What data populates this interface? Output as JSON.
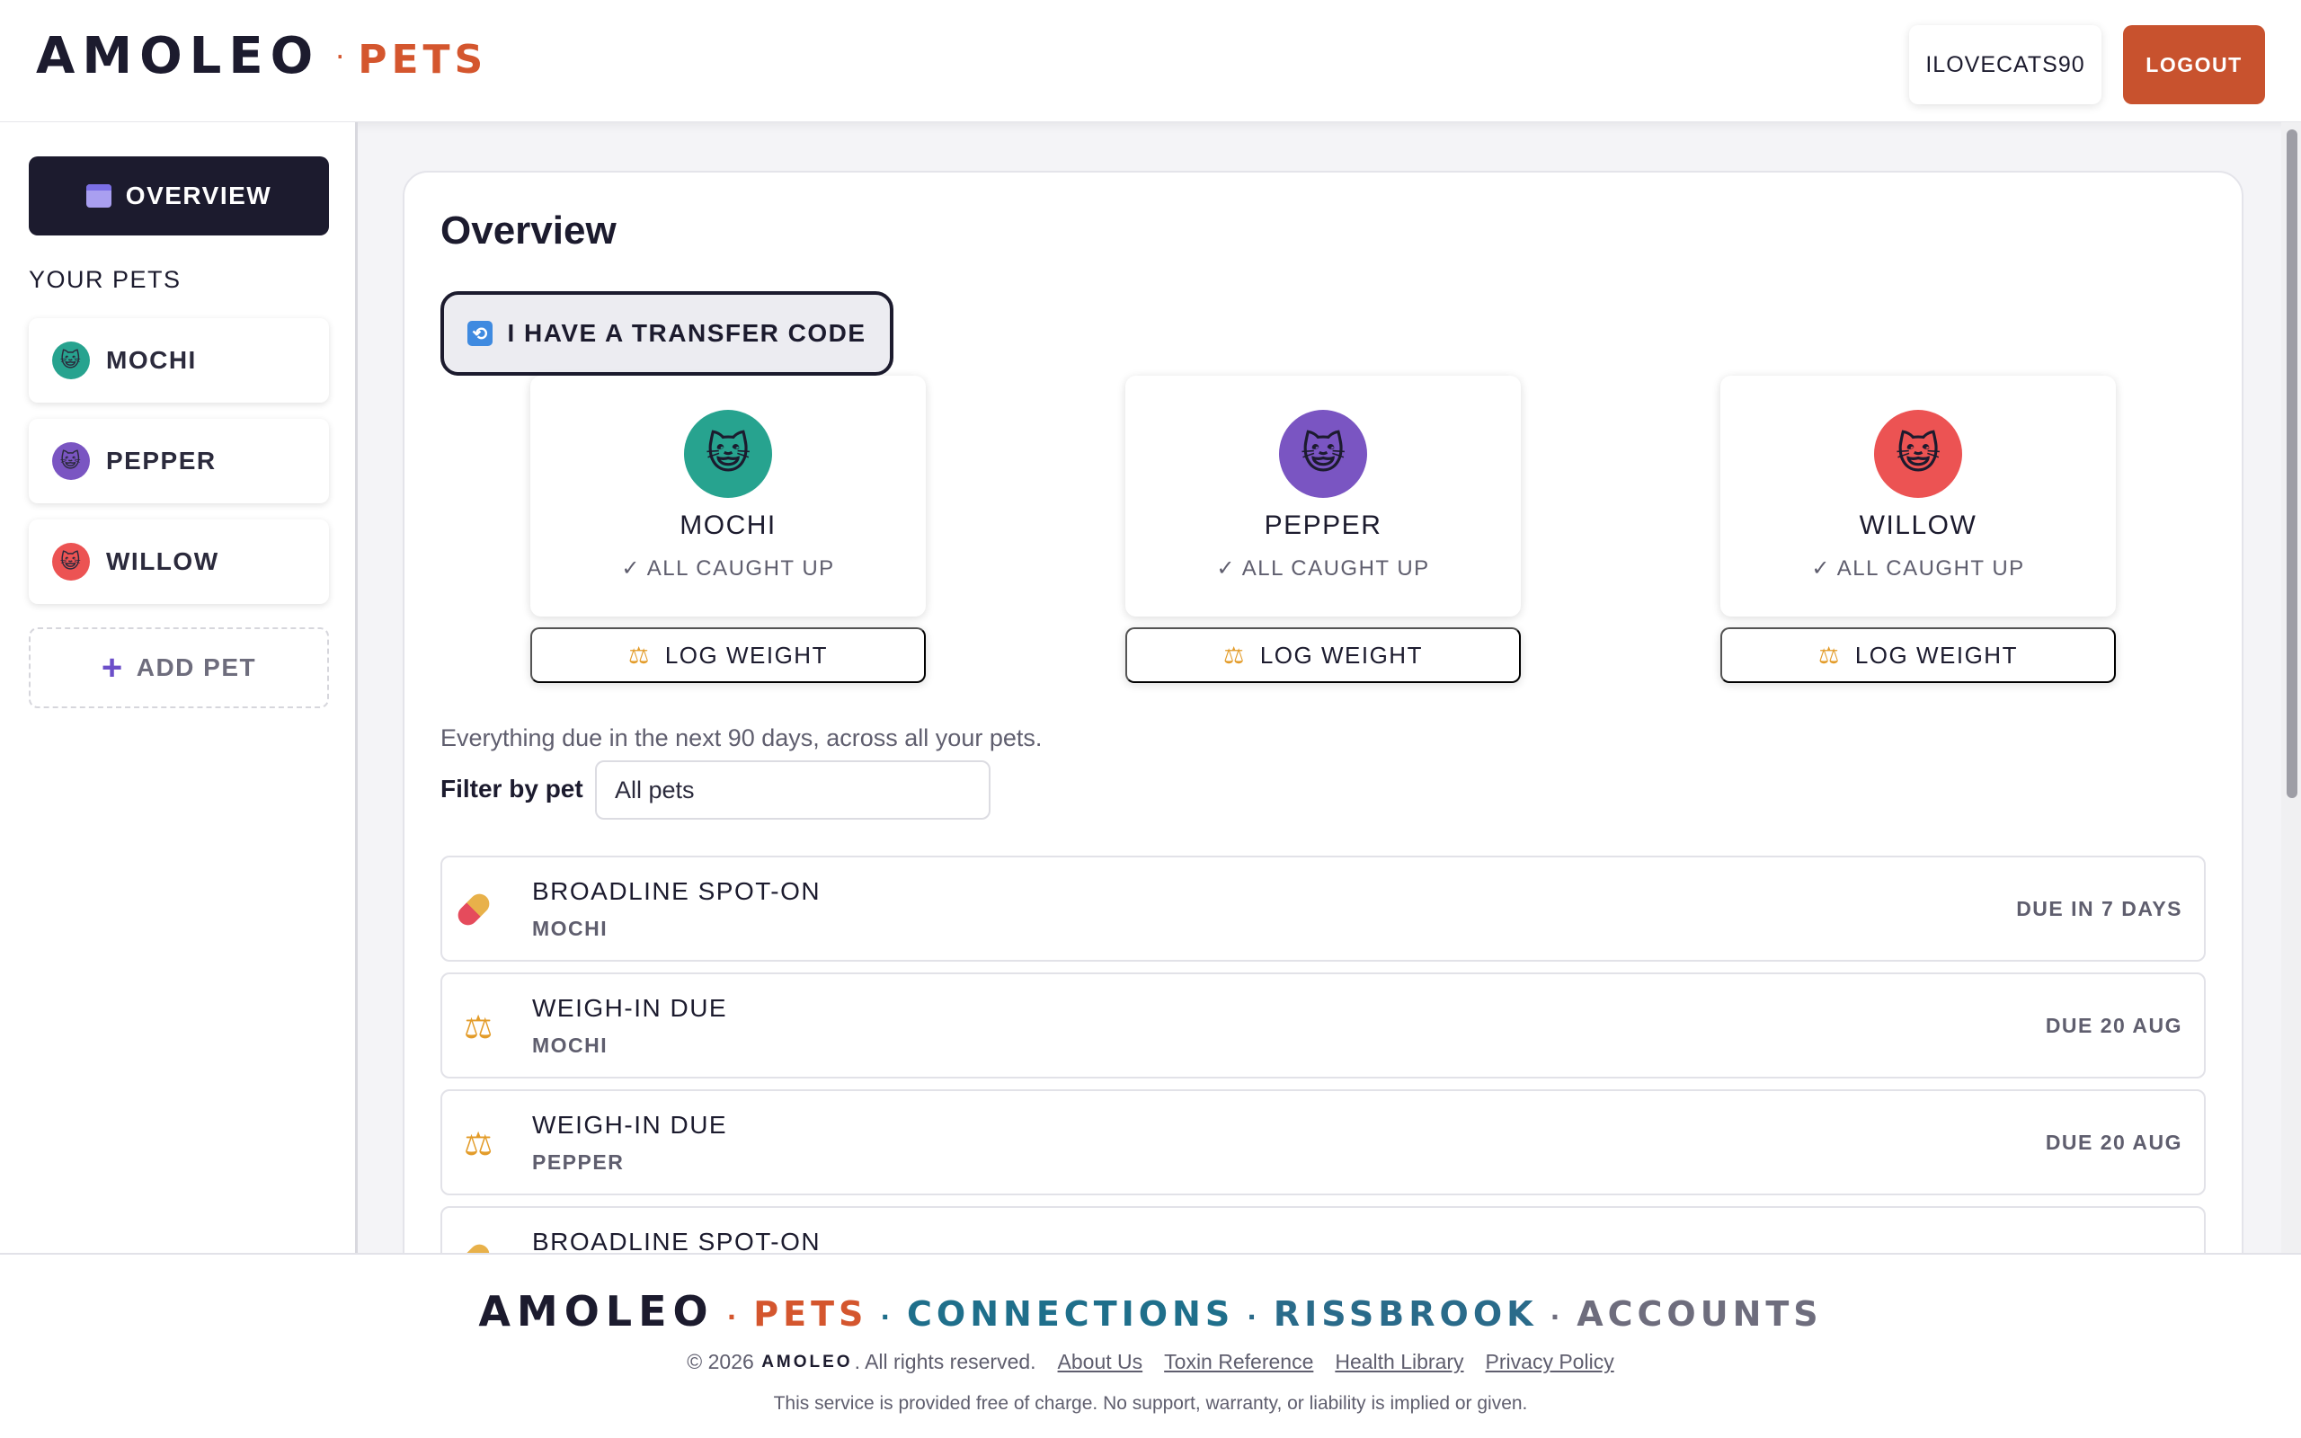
{
  "header": {
    "brand_main": "AMOLEO",
    "brand_dot": "·",
    "brand_sub": "PETS",
    "username": "ILOVECATS90",
    "logout_label": "LOGOUT"
  },
  "sidebar": {
    "overview_label": "OVERVIEW",
    "section_title": "YOUR PETS",
    "pets": [
      {
        "name": "MOCHI",
        "color": "#27a38f"
      },
      {
        "name": "PEPPER",
        "color": "#7a55c2"
      },
      {
        "name": "WILLOW",
        "color": "#ec5353"
      }
    ],
    "add_pet_label": "ADD PET",
    "add_pet_icon": "+"
  },
  "main": {
    "title": "Overview",
    "transfer_label": "I HAVE A TRANSFER CODE",
    "pet_cards": [
      {
        "name": "MOCHI",
        "status": "✓ ALL CAUGHT UP",
        "color": "#27a38f",
        "icon": "cat-face-icon"
      },
      {
        "name": "PEPPER",
        "status": "✓ ALL CAUGHT UP",
        "color": "#7a55c2",
        "icon": "cat-face-icon"
      },
      {
        "name": "WILLOW",
        "status": "✓ ALL CAUGHT UP",
        "color": "#ec5353",
        "icon": "cat-face-icon"
      }
    ],
    "log_weight_label": "LOG WEIGHT",
    "hint": "Everything due in the next 90 days, across all your pets.",
    "filter_label": "Filter by pet",
    "filter_value": "All pets",
    "due_items": [
      {
        "title": "BROADLINE SPOT-ON",
        "pet": "MOCHI",
        "due": "DUE IN 7 DAYS",
        "icon": "pill-icon"
      },
      {
        "title": "WEIGH-IN DUE",
        "pet": "MOCHI",
        "due": "DUE 20 AUG",
        "icon": "scale-icon"
      },
      {
        "title": "WEIGH-IN DUE",
        "pet": "PEPPER",
        "due": "DUE 20 AUG",
        "icon": "scale-icon"
      },
      {
        "title": "BROADLINE SPOT-ON",
        "pet": "",
        "due": "",
        "icon": "pill-icon"
      }
    ]
  },
  "footer": {
    "brand_amoleo": "AMOLEO",
    "dot": "·",
    "brand_pets": "PETS",
    "brand_connections": "CONNECTIONS",
    "brand_rissbrook": "RISSBROOK",
    "brand_accounts": "ACCOUNTS",
    "copyright_prefix": "© 2026",
    "copyright_brand": "AMOLEO",
    "copyright_suffix": ". All rights reserved.",
    "links": [
      "About Us",
      "Toxin Reference",
      "Health Library",
      "Privacy Policy"
    ],
    "note": "This service is provided free of charge. No support, warranty, or liability is implied or given."
  },
  "colors": {
    "accent": "#c8522e",
    "dark": "#1c1b2e"
  }
}
